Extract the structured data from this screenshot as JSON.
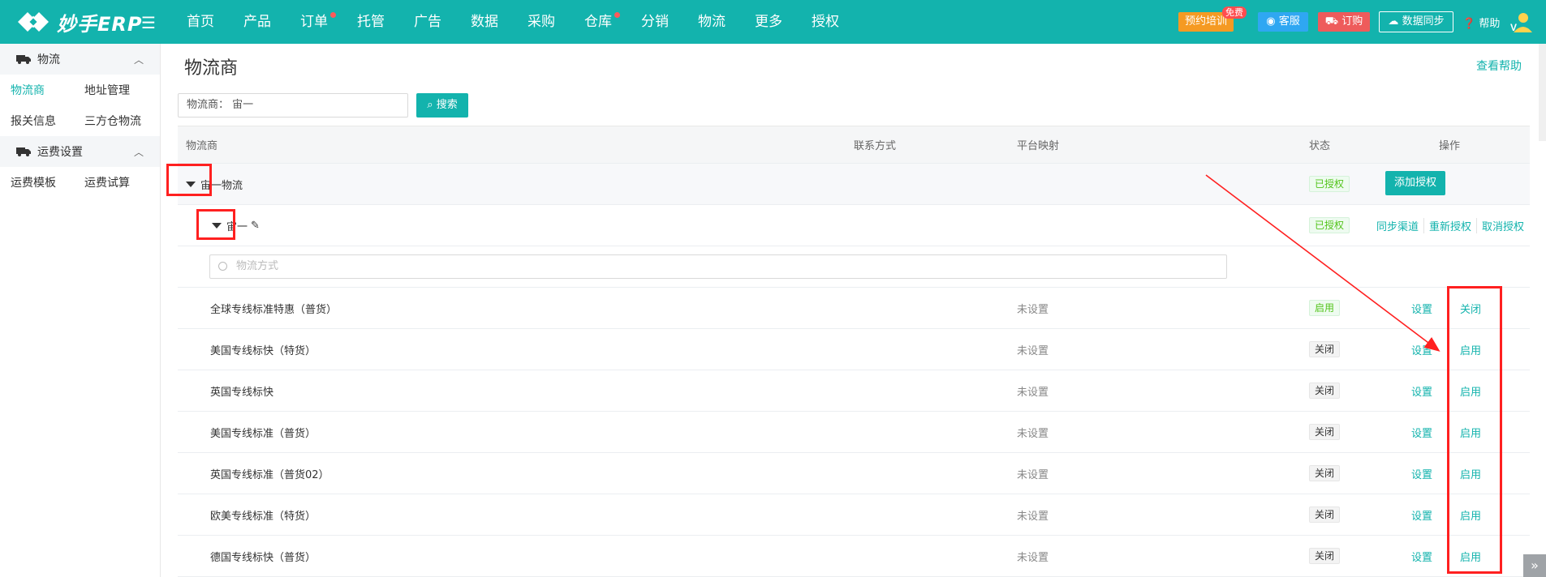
{
  "header": {
    "logo": "妙手ERP",
    "nav": [
      {
        "label": "首页",
        "dot": false
      },
      {
        "label": "产品",
        "dot": false
      },
      {
        "label": "订单",
        "dot": true
      },
      {
        "label": "托管",
        "dot": false
      },
      {
        "label": "广告",
        "dot": false
      },
      {
        "label": "数据",
        "dot": false
      },
      {
        "label": "采购",
        "dot": false
      },
      {
        "label": "仓库",
        "dot": true
      },
      {
        "label": "分销",
        "dot": false
      },
      {
        "label": "物流",
        "dot": false
      },
      {
        "label": "更多",
        "dot": false
      },
      {
        "label": "授权",
        "dot": false
      }
    ],
    "training": "预约培训",
    "free_badge": "免费",
    "service": "客服",
    "order": "订购",
    "sync": "数据同步",
    "help": "帮助"
  },
  "sidebar": {
    "groups": [
      {
        "title": "物流",
        "items": [
          [
            "物流商",
            "地址管理"
          ],
          [
            "报关信息",
            "三方仓物流"
          ]
        ]
      },
      {
        "title": "运费设置",
        "items": [
          [
            "运费模板",
            "运费试算"
          ]
        ]
      }
    ]
  },
  "page": {
    "title": "物流商",
    "help_link": "查看帮助",
    "search_value": "物流商：  宙一",
    "search_button": "搜索"
  },
  "table": {
    "headers": {
      "name": "物流商",
      "contact": "联系方式",
      "map": "平台映射",
      "status": "状态",
      "ops": "操作"
    },
    "provider": {
      "name": "宙一物流",
      "status": "已授权",
      "action": "添加授权"
    },
    "account": {
      "name": "宙一",
      "status": "已授权",
      "ops": [
        "同步渠道",
        "重新授权",
        "取消授权"
      ]
    },
    "method_placeholder": "物流方式",
    "rows": [
      {
        "name": "全球专线标准特惠（普货）",
        "map": "未设置",
        "status": "启用",
        "set": "设置",
        "toggle": "关闭"
      },
      {
        "name": "美国专线标快（特货）",
        "map": "未设置",
        "status": "关闭",
        "set": "设置",
        "toggle": "启用"
      },
      {
        "name": "英国专线标快",
        "map": "未设置",
        "status": "关闭",
        "set": "设置",
        "toggle": "启用"
      },
      {
        "name": "美国专线标准（普货）",
        "map": "未设置",
        "status": "关闭",
        "set": "设置",
        "toggle": "启用"
      },
      {
        "name": "英国专线标准（普货02）",
        "map": "未设置",
        "status": "关闭",
        "set": "设置",
        "toggle": "启用"
      },
      {
        "name": "欧美专线标准（特货）",
        "map": "未设置",
        "status": "关闭",
        "set": "设置",
        "toggle": "启用"
      },
      {
        "name": "德国专线标快（普货）",
        "map": "未设置",
        "status": "关闭",
        "set": "设置",
        "toggle": "启用"
      }
    ]
  },
  "colors": {
    "brand": "#13b3ad",
    "annotation": "#ff2020"
  }
}
